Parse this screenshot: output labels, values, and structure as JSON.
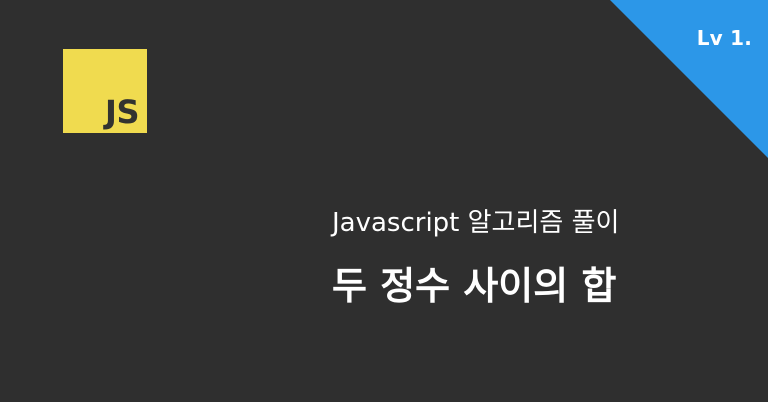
{
  "badge": {
    "level": "Lv 1.",
    "color": "#2c97e8"
  },
  "logo": {
    "text": "JS",
    "icon": "javascript-logo-icon",
    "background": "#f0db4f",
    "text_color": "#323330"
  },
  "heading": {
    "subtitle": "Javascript 알고리즘 풀이",
    "title": "두 정수 사이의 합"
  },
  "colors": {
    "background": "#2f2f2f",
    "text": "#ffffff"
  }
}
